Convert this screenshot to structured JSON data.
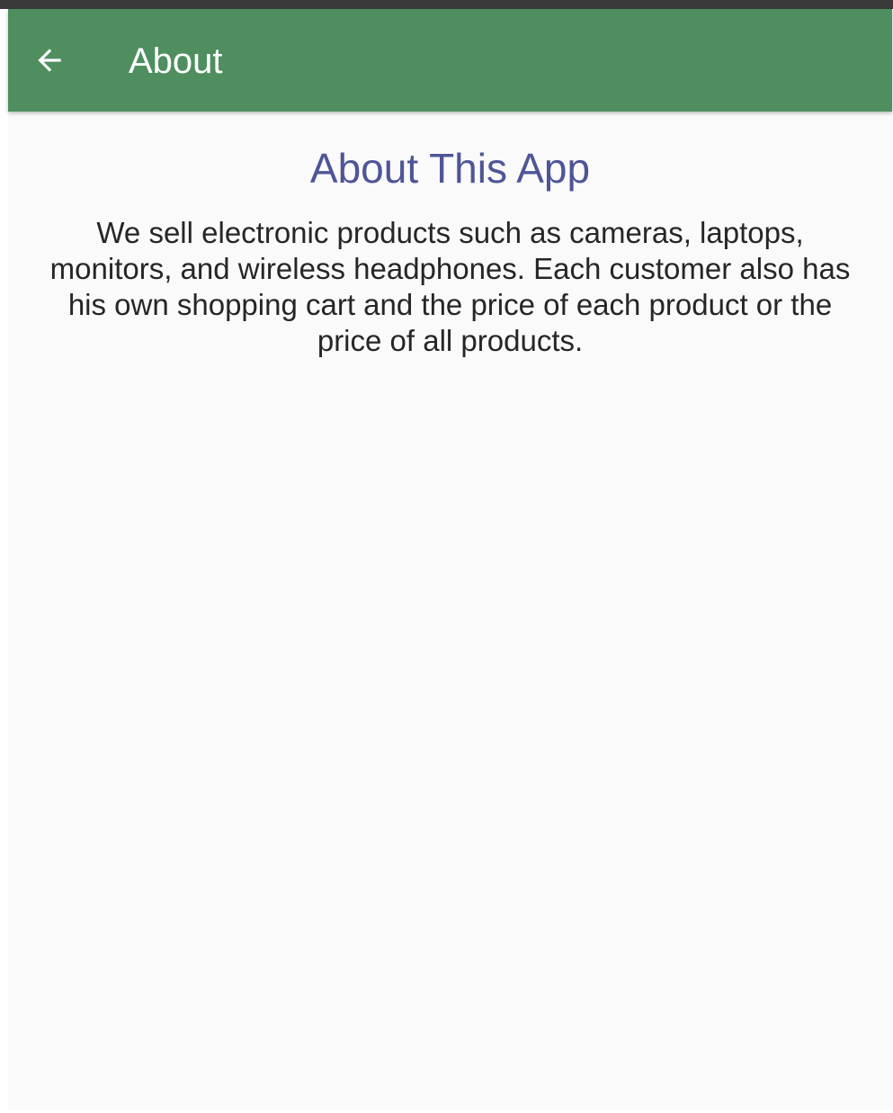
{
  "app_bar": {
    "title": "About",
    "background_color": "#4e8e5f",
    "back_icon": "arrow-left-icon"
  },
  "content": {
    "heading": "About This App",
    "heading_color": "#4e5597",
    "description": "We sell electronic products such as cameras, laptops, monitors, and wireless headphones. Each customer also has his own shopping cart and the price of each product or the price of all products."
  }
}
